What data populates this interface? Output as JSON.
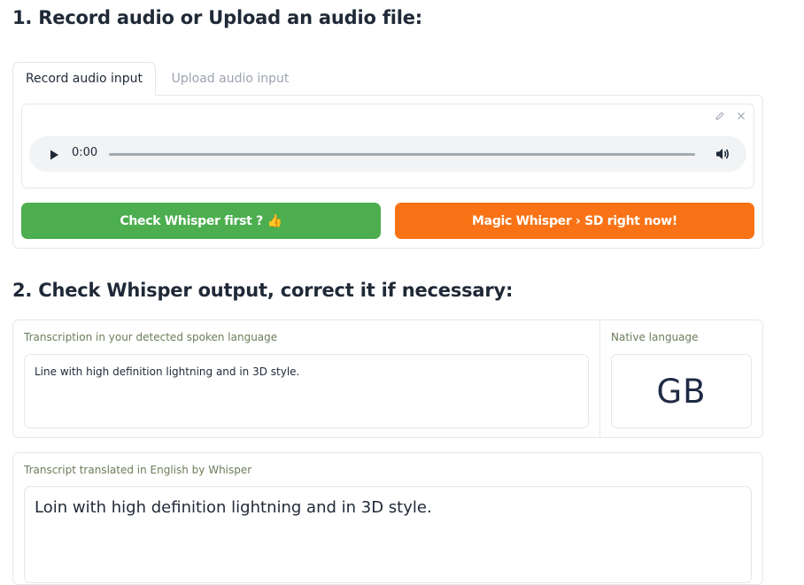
{
  "section1": {
    "title": "1. Record audio or Upload an audio file:"
  },
  "tabs": [
    {
      "label": "Record audio input",
      "active": true
    },
    {
      "label": "Upload audio input",
      "active": false
    }
  ],
  "audio": {
    "time": "0:00",
    "icons": [
      "play-icon",
      "volume-icon",
      "pencil-icon",
      "close-icon"
    ]
  },
  "buttons": {
    "check": "Check Whisper first ? 👍",
    "magic": "Magic Whisper › SD right now!"
  },
  "section2": {
    "title": "2. Check Whisper output, correct it if necessary:"
  },
  "transcription": {
    "label": "Transcription in your detected spoken language",
    "value": "Line with high definition lightning and in 3D style."
  },
  "native": {
    "label": "Native language",
    "value": "GB"
  },
  "translation": {
    "label": "Transcript translated in English by Whisper",
    "value": "Loin with high definition lightning and in 3D style."
  },
  "colors": {
    "check_button": "#4cae4f",
    "magic_button": "#f97316",
    "label_text": "#6b7e5a"
  }
}
